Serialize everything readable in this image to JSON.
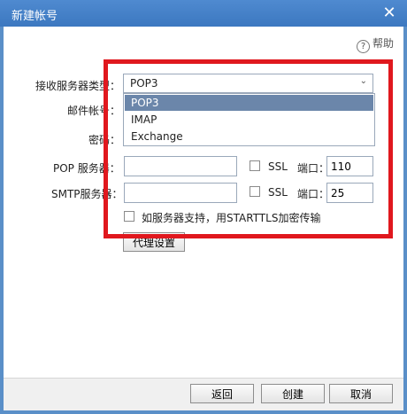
{
  "window": {
    "title": "新建帐号",
    "close_icon": "close-icon"
  },
  "help": {
    "label": "帮助",
    "icon": "help-icon"
  },
  "form": {
    "server_type_label": "接收服务器类型：",
    "server_type_value": "POP3",
    "account_label": "邮件帐号：",
    "password_label": "密码：",
    "pop_label": "POP 服务器：",
    "pop_ssl_label": "SSL",
    "pop_port_label": "端口：",
    "pop_port_value": "110",
    "smtp_label": "SMTP服务器：",
    "smtp_ssl_label": "SSL",
    "smtp_port_label": "端口：",
    "smtp_port_value": "25",
    "starttls_label": "如服务器支持，用STARTTLS加密传输",
    "proxy_button": "代理设置"
  },
  "dropdown": {
    "options": [
      "POP3",
      "IMAP",
      "Exchange"
    ],
    "selected": "POP3"
  },
  "footer": {
    "back_button": "返回",
    "create_button": "创建",
    "cancel_button": "取消"
  },
  "colors": {
    "titlebar": "#3c78c0",
    "selection": "#6b86aa",
    "highlight_border": "#e0181e"
  }
}
